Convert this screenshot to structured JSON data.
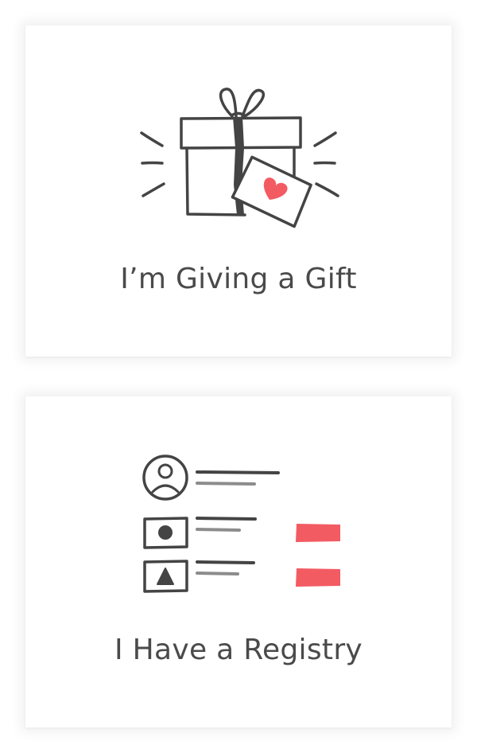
{
  "options": [
    {
      "title": "I’m Giving a Gift",
      "icon": "gift-box-with-heart-tag-icon"
    },
    {
      "title": "I Have a Registry",
      "icon": "registry-list-icon"
    }
  ],
  "colors": {
    "line": "#444444",
    "muted_line": "#8c8c8c",
    "accent": "#f35b63",
    "text": "#4a4a4a"
  }
}
